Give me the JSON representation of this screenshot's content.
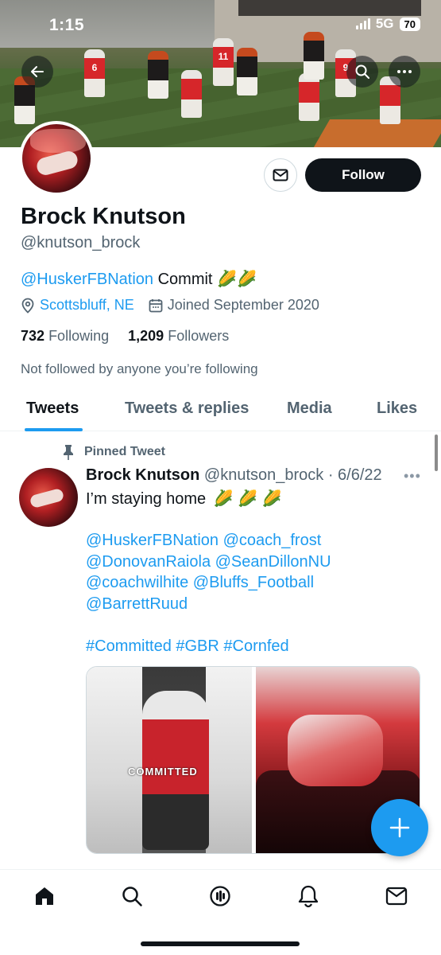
{
  "status": {
    "time": "1:15",
    "network": "5G",
    "battery": "70"
  },
  "profile": {
    "name": "Brock Knutson",
    "handle": "@knutson_brock",
    "bio_mention": "@HuskerFBNation",
    "bio_text": "Commit 🌽🌽",
    "location": "Scottsbluff, NE",
    "joined": "Joined September 2020",
    "following_count": "732",
    "following_label": "Following",
    "followers_count": "1,209",
    "followers_label": "Followers",
    "not_followed": "Not followed by anyone you’re following",
    "follow_label": "Follow"
  },
  "tabs": [
    {
      "label": "Tweets",
      "active": true
    },
    {
      "label": "Tweets & replies",
      "active": false
    },
    {
      "label": "Media",
      "active": false
    },
    {
      "label": "Likes",
      "active": false
    }
  ],
  "tweet": {
    "pinned_label": "Pinned Tweet",
    "author": "Brock Knutson",
    "handle_date": "@knutson_brock · 6/6/22",
    "text": "I’m staying home",
    "emoji": "🌽 🌽 🌽",
    "mentions_1": "@HuskerFBNation @coach_frost",
    "mentions_2": "@DonovanRaiola @SeanDillonNU",
    "mentions_3": "@coachwilhite @Bluffs_Football",
    "mentions_4": "@BarrettRuud",
    "hashtags": "#Committed #GBR #Cornfed",
    "media_caption": "COMMITTED"
  },
  "banner": {
    "jersey_numbers": [
      "6",
      "11",
      "9"
    ]
  },
  "icons": {
    "back": "back-arrow-icon",
    "search": "search-icon",
    "more": "more-icon",
    "message": "envelope-icon",
    "location": "location-pin-icon",
    "calendar": "calendar-icon",
    "pin": "pin-icon",
    "compose": "plus-icon",
    "nav": [
      "home-icon",
      "search-icon",
      "spaces-icon",
      "bell-icon",
      "envelope-icon"
    ]
  },
  "colors": {
    "accent": "#1d9bf0",
    "text": "#0f1419",
    "secondary": "#536471"
  }
}
